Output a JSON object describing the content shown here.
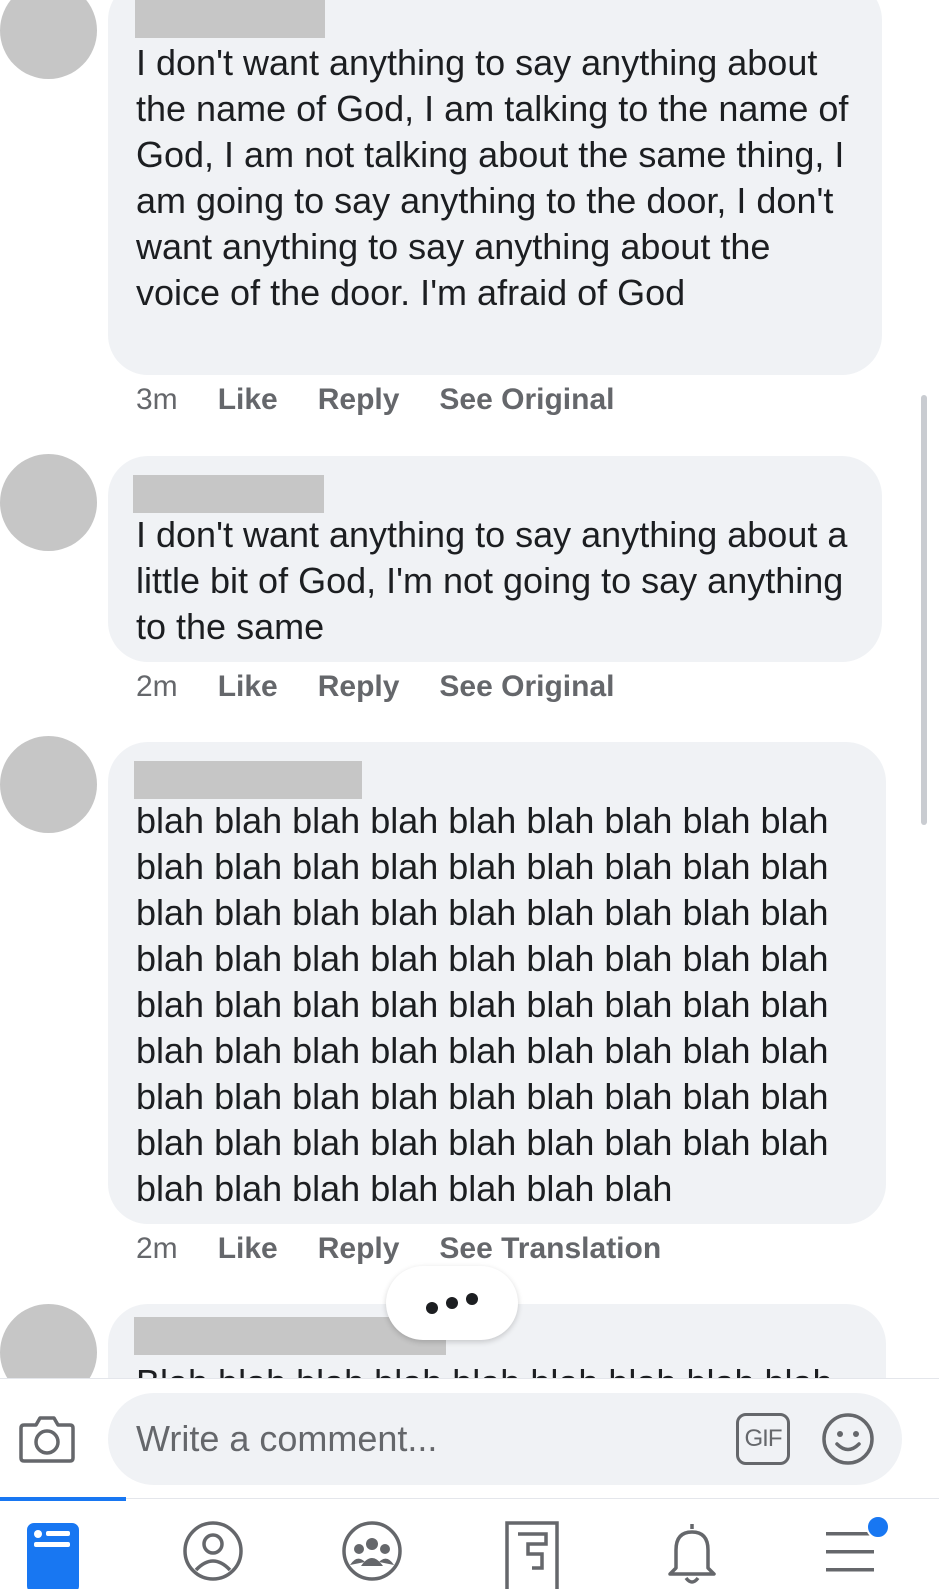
{
  "comments": [
    {
      "text": "I don't want anything to say anything about the name of God, I am talking to the name of God, I am not talking about the same thing, I am going to say anything to the door, I don't want anything to say anything about the voice of the door. I'm afraid of God",
      "time": "3m",
      "like": "Like",
      "reply": "Reply",
      "extra": "See Original"
    },
    {
      "text": "I don't want anything to say anything about a little bit of God, I'm not going to say anything to the same",
      "time": "2m",
      "like": "Like",
      "reply": "Reply",
      "extra": "See Original"
    },
    {
      "text": "blah blah blah blah blah blah blah blah blah blah blah blah blah blah blah blah blah blah blah blah blah blah blah blah blah blah blah blah blah blah blah blah blah blah blah blah blah blah blah blah blah blah blah blah blah blah blah blah blah blah blah blah blah blah blah blah blah blah blah blah blah blah blah blah blah blah blah blah blah blah blah blah blah blah blah blah blah blah blah",
      "time": "2m",
      "like": "Like",
      "reply": "Reply",
      "extra": "See Translation"
    },
    {
      "text": "Blah blah blah blah blah blah blah blah blah"
    }
  ],
  "composer": {
    "placeholder": "Write a comment...",
    "gif_label": "GIF"
  },
  "icons": {
    "camera": "camera-icon",
    "emoji": "smiley-icon",
    "tabs": [
      "news-feed-icon",
      "profile-icon",
      "groups-icon",
      "pages-icon",
      "notifications-icon",
      "menu-icon"
    ]
  },
  "colors": {
    "bubble": "#f0f2f5",
    "accent": "#1877f2",
    "meta_text": "#65676b",
    "redaction": "#c6c6c6"
  }
}
